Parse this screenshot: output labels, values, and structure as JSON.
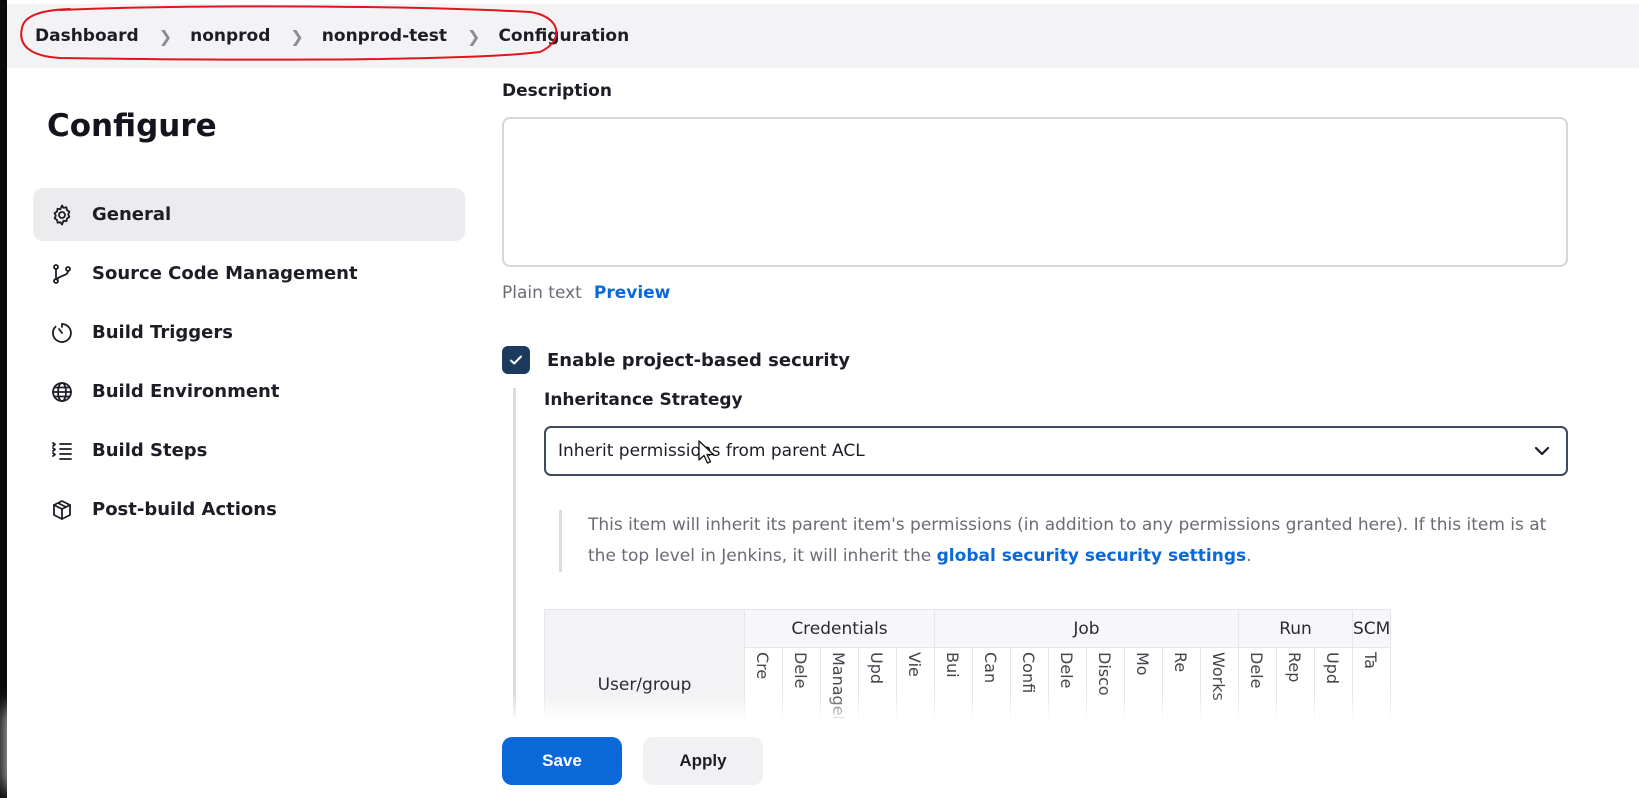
{
  "breadcrumb": {
    "items": [
      {
        "label": "Dashboard"
      },
      {
        "label": "nonprod"
      },
      {
        "label": "nonprod-test"
      },
      {
        "label": "Configuration"
      }
    ],
    "annotation_color": "#e0161f"
  },
  "sidebar": {
    "title": "Configure",
    "items": [
      {
        "label": "General",
        "icon": "gear-icon",
        "active": true
      },
      {
        "label": "Source Code Management",
        "icon": "git-branch-icon",
        "active": false
      },
      {
        "label": "Build Triggers",
        "icon": "timer-icon",
        "active": false
      },
      {
        "label": "Build Environment",
        "icon": "globe-icon",
        "active": false
      },
      {
        "label": "Build Steps",
        "icon": "list-steps-icon",
        "active": false
      },
      {
        "label": "Post-build Actions",
        "icon": "package-icon",
        "active": false
      }
    ]
  },
  "main": {
    "description_label": "Description",
    "description_value": "",
    "format_plain": "Plain text",
    "format_preview": "Preview",
    "security_checkbox_label": "Enable project-based security",
    "security_checked": true,
    "inheritance_label": "Inheritance Strategy",
    "inheritance_value": "Inherit permissions from parent ACL",
    "info_text_1": "This item will inherit its parent item's permissions (in addition to any permissions granted here). If this item is at the top level in Jenkins, it will inherit the ",
    "info_link": "global security security settings",
    "info_text_2": "."
  },
  "permissions": {
    "user_header": "User/group",
    "groups": [
      {
        "name": "Credentials",
        "columns": [
          "Cre",
          "Dele",
          "ManageD",
          "Upd",
          "Vie"
        ]
      },
      {
        "name": "Job",
        "columns": [
          "Bui",
          "Can",
          "Confi",
          "Dele",
          "Disco",
          "Mo",
          "Re",
          "Works"
        ]
      },
      {
        "name": "Run",
        "columns": [
          "Dele",
          "Rep",
          "Upd"
        ]
      },
      {
        "name": "SCM",
        "columns": [
          "Ta"
        ]
      }
    ]
  },
  "actions": {
    "save_label": "Save",
    "apply_label": "Apply"
  },
  "colors": {
    "accent": "#0b68d8",
    "checkbox": "#1b3a5c"
  }
}
